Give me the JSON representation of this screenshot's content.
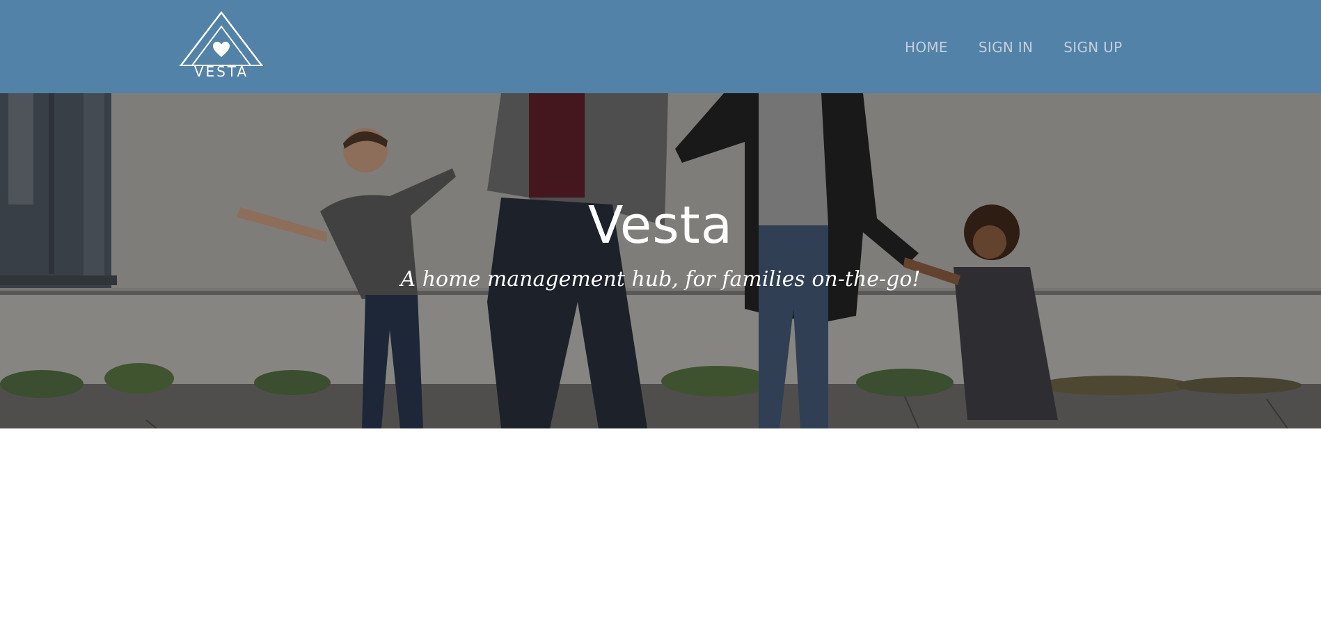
{
  "brand": {
    "logo_text": "VESTA"
  },
  "nav": {
    "items": [
      {
        "label": "HOME"
      },
      {
        "label": "SIGN IN"
      },
      {
        "label": "SIGN UP"
      }
    ]
  },
  "hero": {
    "title": "Vesta",
    "subtitle": "A home management hub, for families on-the-go!"
  },
  "colors": {
    "navbar_bg": "#5282a8",
    "nav_link": "#c4cfdc",
    "hero_text": "#ffffff"
  },
  "icons": {
    "logo": "house-heart-icon"
  }
}
